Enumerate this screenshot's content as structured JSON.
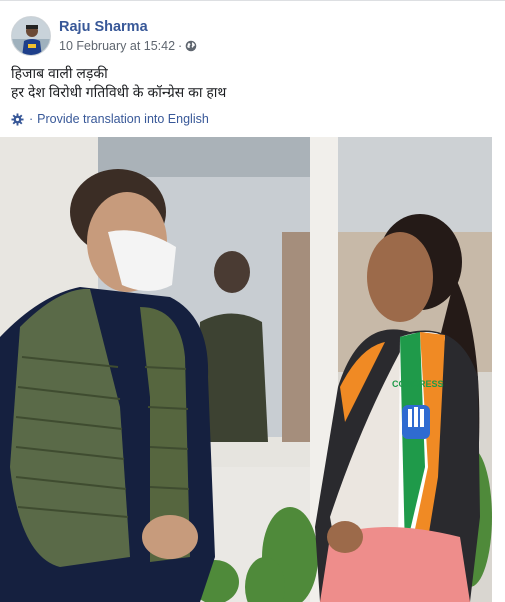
{
  "post": {
    "author": "Raju Sharma",
    "timestamp": "10 February at 15:42",
    "separator": "·",
    "audience_icon": "globe-icon",
    "message_lines": [
      "हिजाब वाली लड़की",
      "हर देश विरोधी गतिविधी के कॉन्ग्रेस का हाथ"
    ],
    "translate_icon": "gear-icon",
    "translate_label": "Provide translation into English",
    "photo_badge_text": "CONGRESS"
  },
  "colors": {
    "link": "#385898",
    "meta_text": "#606770",
    "body_text": "#1c1e21",
    "saffron": "#f08a24",
    "green": "#1f9a4a"
  }
}
